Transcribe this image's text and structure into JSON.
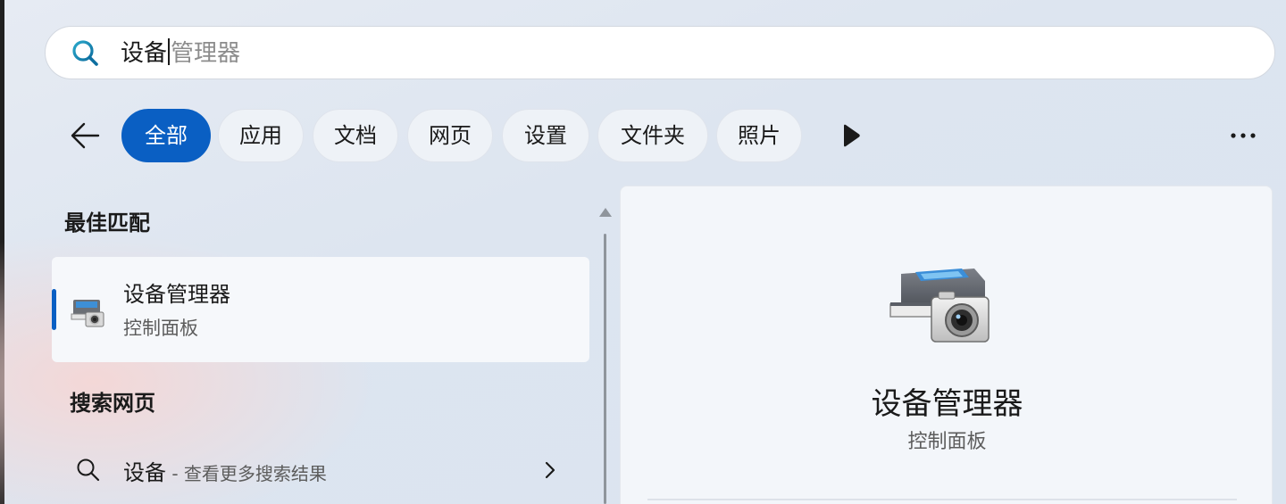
{
  "search": {
    "typed": "设备",
    "suggestion": "管理器"
  },
  "filters": {
    "chips": [
      "全部",
      "应用",
      "文档",
      "网页",
      "设置",
      "文件夹",
      "照片"
    ],
    "active_index": 0
  },
  "best_match": {
    "heading": "最佳匹配",
    "title": "设备管理器",
    "subtitle": "控制面板"
  },
  "web_search": {
    "heading": "搜索网页",
    "query": "设备",
    "hint": " - 查看更多搜索结果"
  },
  "preview": {
    "title": "设备管理器",
    "subtitle": "控制面板"
  },
  "colors": {
    "accent": "#0a5fc3",
    "search_icon_teal": "#1a8a9a"
  },
  "icons": {
    "search": "search-icon",
    "back": "arrow-left-icon",
    "more_filters": "play-triangle-icon",
    "overflow": "more-dots-icon",
    "app": "device-manager-icon",
    "chevron": "chevron-right-icon"
  }
}
